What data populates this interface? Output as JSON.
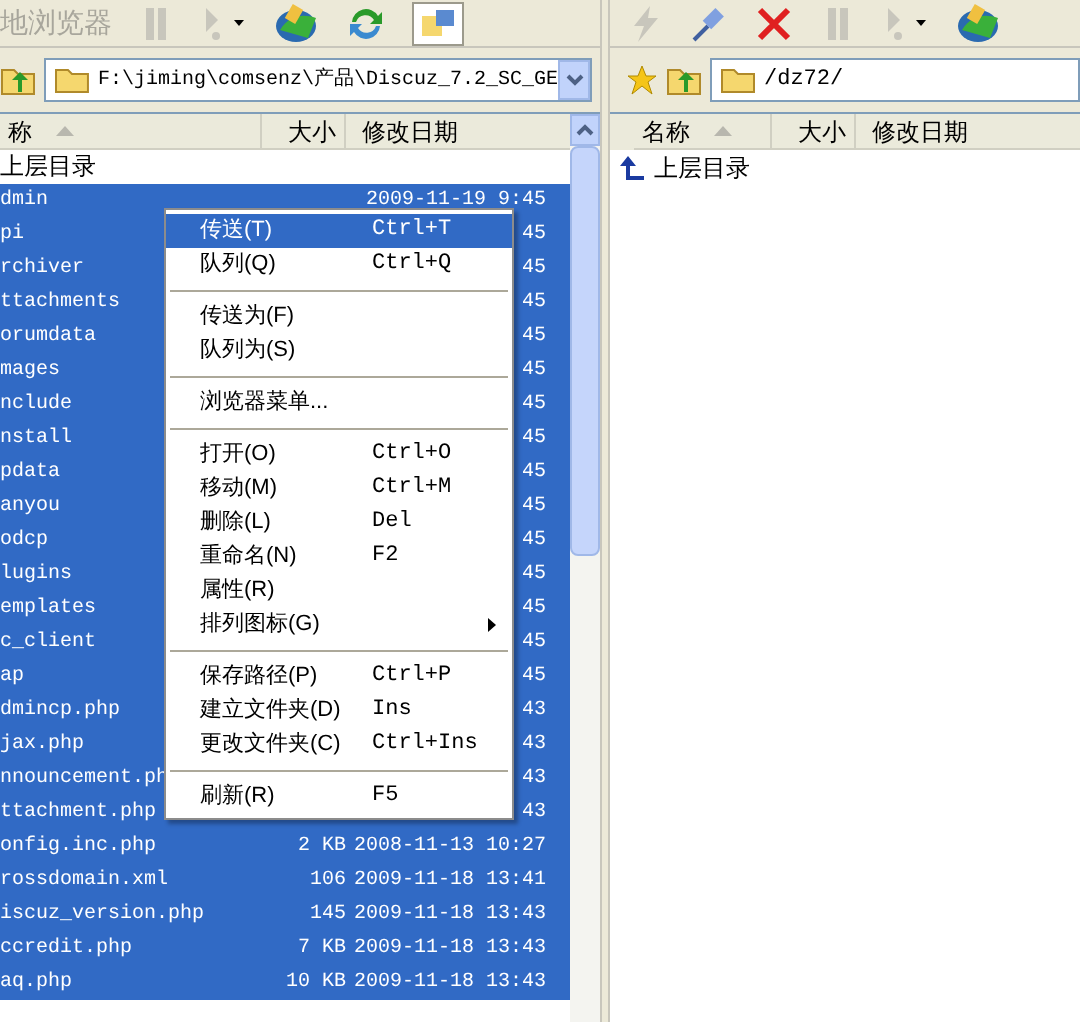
{
  "left": {
    "title": "地浏览器",
    "path": "F:\\jiming\\comsenz\\产品\\Discuz_7.2_SC_GE",
    "columns": [
      "称",
      "大小",
      "修改日期"
    ],
    "parent": "上层目录",
    "rows": [
      {
        "name": "dmin",
        "size": "",
        "date": "2009-11-19 9:45",
        "selected": true
      },
      {
        "name": "pi",
        "size": "",
        "date": "45",
        "selected": true
      },
      {
        "name": "rchiver",
        "size": "",
        "date": "45",
        "selected": true
      },
      {
        "name": "ttachments",
        "size": "",
        "date": "45",
        "selected": true
      },
      {
        "name": "orumdata",
        "size": "",
        "date": "45",
        "selected": true
      },
      {
        "name": "mages",
        "size": "",
        "date": "45",
        "selected": true
      },
      {
        "name": "nclude",
        "size": "",
        "date": "45",
        "selected": true
      },
      {
        "name": "nstall",
        "size": "",
        "date": "45",
        "selected": true
      },
      {
        "name": "pdata",
        "size": "",
        "date": "45",
        "selected": true
      },
      {
        "name": "anyou",
        "size": "",
        "date": "45",
        "selected": true
      },
      {
        "name": "odcp",
        "size": "",
        "date": "45",
        "selected": true
      },
      {
        "name": "lugins",
        "size": "",
        "date": "45",
        "selected": true
      },
      {
        "name": "emplates",
        "size": "",
        "date": "45",
        "selected": true
      },
      {
        "name": "c_client",
        "size": "",
        "date": "45",
        "selected": true
      },
      {
        "name": "ap",
        "size": "",
        "date": "45",
        "selected": true
      },
      {
        "name": "dmincp.php",
        "size": "",
        "date": "43",
        "selected": true
      },
      {
        "name": "jax.php",
        "size": "",
        "date": "43",
        "selected": true
      },
      {
        "name": "nnouncement.ph",
        "size": "",
        "date": "43",
        "selected": true
      },
      {
        "name": "ttachment.php",
        "size": "",
        "date": "43",
        "selected": true
      },
      {
        "name": "onfig.inc.php",
        "size": "2 KB",
        "date": "2008-11-13 10:27",
        "selected": true
      },
      {
        "name": "rossdomain.xml",
        "size": "106",
        "date": "2009-11-18 13:41",
        "selected": true
      },
      {
        "name": "iscuz_version.php",
        "size": "145",
        "date": "2009-11-18 13:43",
        "selected": true
      },
      {
        "name": "ccredit.php",
        "size": "7 KB",
        "date": "2009-11-18 13:43",
        "selected": true
      },
      {
        "name": "aq.php",
        "size": "10 KB",
        "date": "2009-11-18 13:43",
        "selected": true
      }
    ]
  },
  "right": {
    "path": "/dz72/",
    "columns": [
      "名称",
      "大小",
      "修改日期"
    ],
    "parent": "上层目录"
  },
  "menu": [
    {
      "kind": "item",
      "label": "传送(T)",
      "shortcut": "Ctrl+T",
      "selected": true
    },
    {
      "kind": "item",
      "label": "队列(Q)",
      "shortcut": "Ctrl+Q",
      "selected": false
    },
    {
      "kind": "separator"
    },
    {
      "kind": "item",
      "label": "传送为(F)",
      "selected": false
    },
    {
      "kind": "item",
      "label": "队列为(S)",
      "selected": false
    },
    {
      "kind": "separator"
    },
    {
      "kind": "item",
      "label": "浏览器菜单...",
      "selected": false
    },
    {
      "kind": "separator"
    },
    {
      "kind": "item",
      "label": "打开(O)",
      "shortcut": "Ctrl+O",
      "selected": false
    },
    {
      "kind": "item",
      "label": "移动(M)",
      "shortcut": "Ctrl+M",
      "selected": false
    },
    {
      "kind": "item",
      "label": "删除(L)",
      "shortcut": "Del",
      "selected": false
    },
    {
      "kind": "item",
      "label": "重命名(N)",
      "shortcut": "F2",
      "selected": false
    },
    {
      "kind": "item",
      "label": "属性(R)",
      "selected": false
    },
    {
      "kind": "item",
      "label": "排列图标(G)",
      "selected": false,
      "submenu": true
    },
    {
      "kind": "separator"
    },
    {
      "kind": "item",
      "label": "保存路径(P)",
      "shortcut": "Ctrl+P",
      "selected": false
    },
    {
      "kind": "item",
      "label": "建立文件夹(D)",
      "shortcut": "Ins",
      "selected": false
    },
    {
      "kind": "item",
      "label": "更改文件夹(C)",
      "shortcut": "Ctrl+Ins",
      "selected": false
    },
    {
      "kind": "separator"
    },
    {
      "kind": "item",
      "label": "刷新(R)",
      "shortcut": "F5",
      "selected": false
    }
  ]
}
